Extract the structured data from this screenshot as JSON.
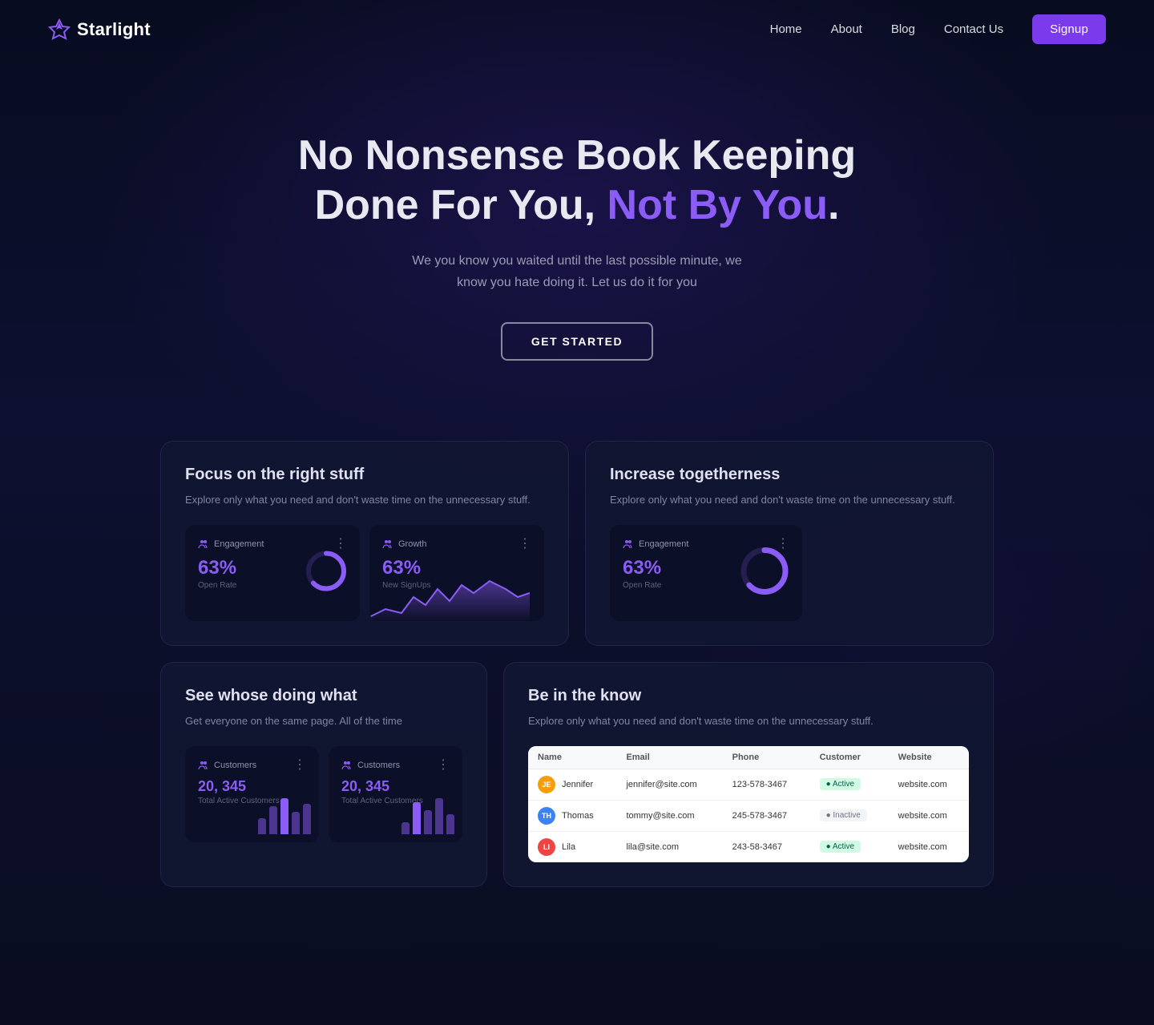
{
  "nav": {
    "logo_text": "Starlight",
    "links": [
      {
        "label": "Home",
        "id": "home"
      },
      {
        "label": "About",
        "id": "about"
      },
      {
        "label": "Blog",
        "id": "blog"
      },
      {
        "label": "Contact Us",
        "id": "contact"
      }
    ],
    "signup_label": "Signup"
  },
  "hero": {
    "title_line1": "No Nonsense Book Keeping",
    "title_line2_normal": "Done ",
    "title_line2_bold": "For You, ",
    "title_line2_highlight": "Not By You",
    "title_line2_dot": ".",
    "subtitle": "We you know you waited until the last possible minute, we know you hate doing it. Let us do it for you",
    "cta_label": "GET STARTED"
  },
  "features": [
    {
      "id": "focus",
      "title": "Focus on the right stuff",
      "desc": "Explore only what you need and don't waste time on the unnecessary stuff.",
      "cards": [
        {
          "id": "engagement",
          "label": "Engagement",
          "value": "63%",
          "sub": "Open Rate",
          "type": "donut"
        },
        {
          "id": "growth",
          "label": "Growth",
          "value": "63%",
          "sub": "New SignUps",
          "type": "area"
        }
      ]
    },
    {
      "id": "togetherness",
      "title": "Increase togetherness",
      "desc": "Explore only what you need and don't waste time on the unnecessary stuff.",
      "card": {
        "label": "Engagement",
        "value": "63%",
        "sub": "Open Rate",
        "type": "donut"
      }
    }
  ],
  "bottom_features": [
    {
      "id": "whose",
      "title": "See whose doing what",
      "desc": "Get everyone on the same page.\nAll of the time",
      "cards": [
        {
          "label": "Customers",
          "value": "20, 345",
          "sub": "Total Active Customers",
          "type": "bar"
        },
        {
          "label": "Customers",
          "value": "20, 345",
          "sub": "Total Active Customers",
          "type": "bar"
        }
      ]
    },
    {
      "id": "know",
      "title": "Be in the know",
      "desc": "Explore only what you need and don't waste time on the unnecessary stuff.",
      "table": {
        "headers": [
          "Name",
          "Email",
          "Phone",
          "Customer",
          "Website"
        ],
        "rows": [
          {
            "name": "Jennifer",
            "email": "jennifer@site.com",
            "phone": "123-578-3467",
            "status": "Active",
            "status_type": "active",
            "website": "website.com",
            "avatar_color": "#f59e0b",
            "initials": "JE"
          },
          {
            "name": "Thomas",
            "email": "tommy@site.com",
            "phone": "245-578-3467",
            "status": "Inactive",
            "status_type": "inactive",
            "website": "website.com",
            "avatar_color": "#3b82f6",
            "initials": "TH"
          },
          {
            "name": "Lila",
            "email": "lila@site.com",
            "phone": "243-58-3467",
            "status": "Active",
            "status_type": "active",
            "website": "website.com",
            "avatar_color": "#ef4444",
            "initials": "LI"
          }
        ]
      }
    }
  ],
  "colors": {
    "accent": "#8b5cf6",
    "accent_dark": "#7c3aed",
    "bg": "#0a0d1f"
  }
}
